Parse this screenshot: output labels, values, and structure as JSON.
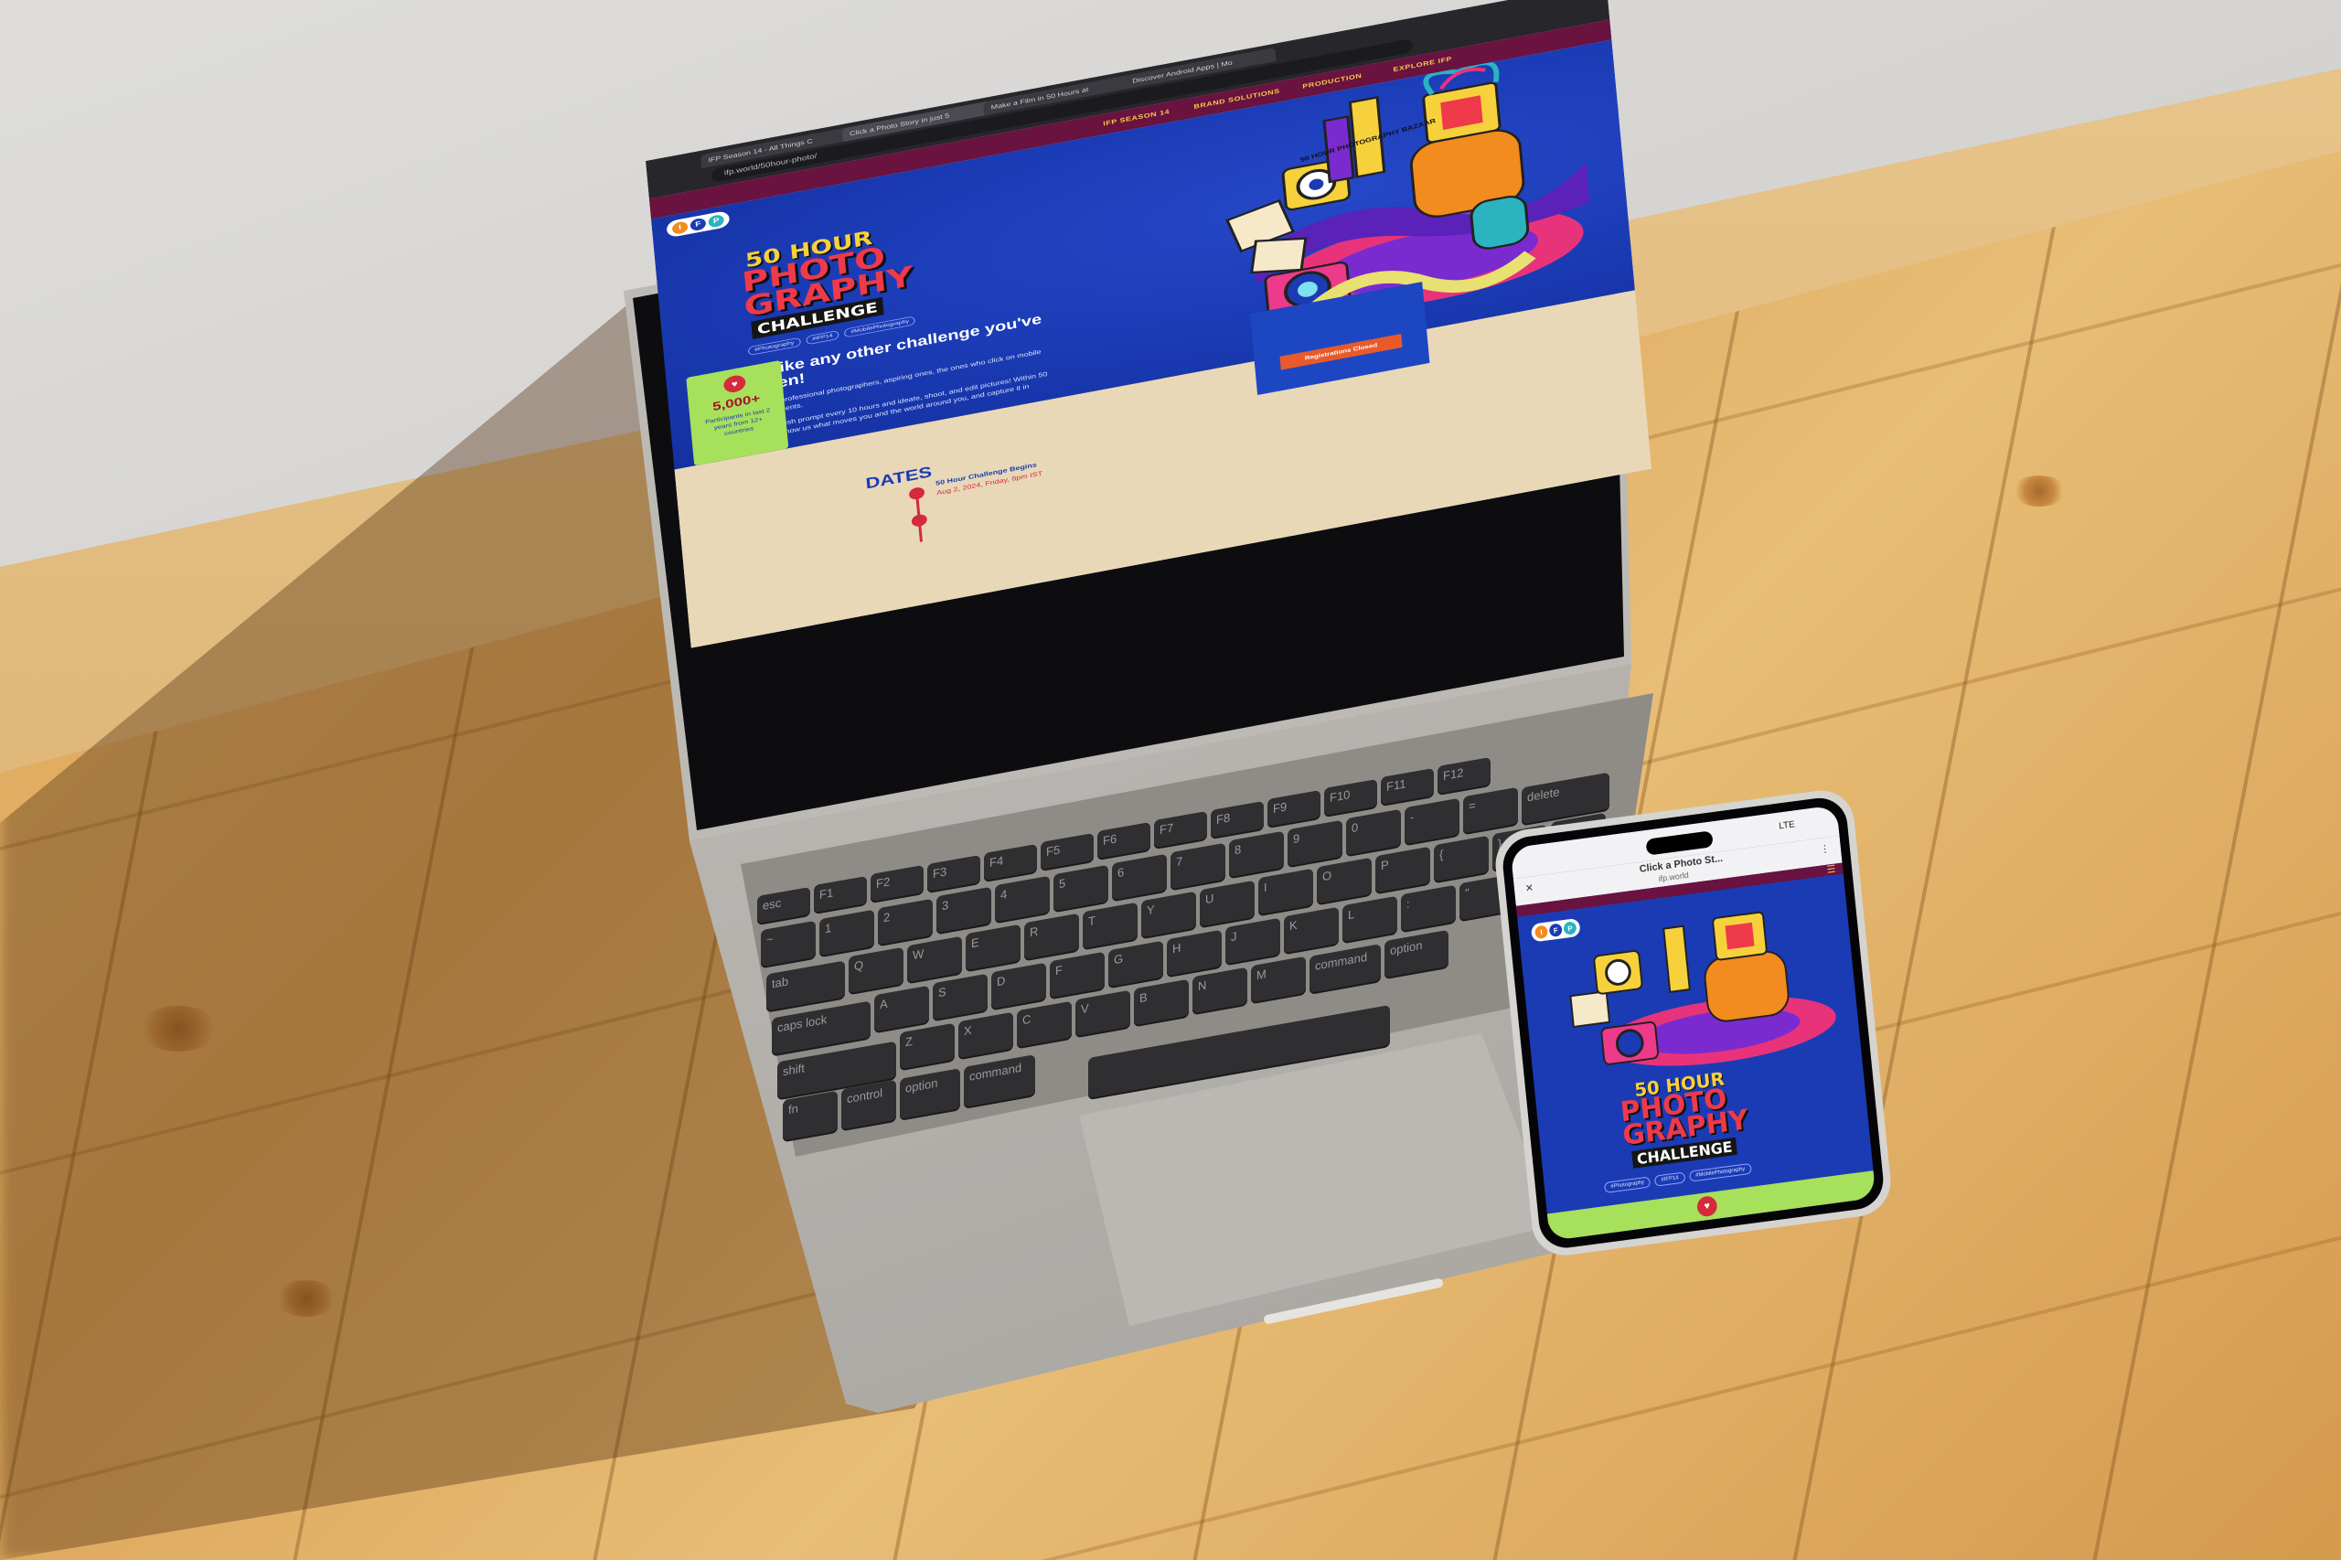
{
  "browser": {
    "tabs": [
      "IFP Season 14 - All Things C",
      "Click a Photo Story in just 5",
      "Make a Film in 50 Hours at",
      "Discover Android Apps | Mo"
    ],
    "address": "ifp.world/50hour-photo/"
  },
  "site": {
    "logo": [
      "I",
      "F",
      "P"
    ],
    "nav": [
      "IFP SEASON 14",
      "BRAND SOLUTIONS",
      "PRODUCTION",
      "EXPLORE IFP"
    ],
    "title_top": "50 HOUR",
    "title_photo": "PHOTO",
    "title_graphy": "GRAPHY",
    "title_bottom": "CHALLENGE",
    "hashtags": [
      "#Photography",
      "#IFP14",
      "#MobilePhotography"
    ],
    "headline": "Unlike any other challenge you've taken!",
    "body_1": "Calling professional photographers, aspiring ones, the ones who click on mobile and students.",
    "body_2": "Get a fresh prompt every 10 hours and ideate, shoot, and edit pictures! Within 50 hours, show us what moves you and the world around you, and capture it in frames.",
    "illustration_label": "50 HOUR PHOTOGRAPHY BAZAAR",
    "stat_number": "5,000+",
    "stat_caption": "Participants in last 2 years from 12+ countries",
    "registration_button": "Registrations Closed",
    "dates_title": "DATES",
    "date_label": "50 Hour Challenge Begins",
    "date_value": "Aug 2, 2024, Friday, 8pm IST"
  },
  "phone": {
    "tab_title": "Click a Photo St...",
    "url": "ifp.world",
    "status_right": "LTE",
    "title_top": "50 HOUR",
    "title_photo": "PHOTO",
    "title_graphy": "GRAPHY",
    "title_bottom": "CHALLENGE",
    "hashtags": [
      "#Photography",
      "#IFP14",
      "#MobilePhotography"
    ]
  },
  "keyboard": {
    "row_fn": [
      "esc",
      "F1",
      "F2",
      "F3",
      "F4",
      "F5",
      "F6",
      "F7",
      "F8",
      "F9",
      "F10",
      "F11",
      "F12"
    ],
    "row_num": [
      "~",
      "1",
      "2",
      "3",
      "4",
      "5",
      "6",
      "7",
      "8",
      "9",
      "0",
      "-",
      "=",
      "delete"
    ],
    "row_q": [
      "tab",
      "Q",
      "W",
      "E",
      "R",
      "T",
      "Y",
      "U",
      "I",
      "O",
      "P",
      "{",
      "}",
      "|"
    ],
    "row_a": [
      "caps lock",
      "A",
      "S",
      "D",
      "F",
      "G",
      "H",
      "J",
      "K",
      "L",
      ":",
      "\""
    ],
    "row_z": [
      "shift",
      "Z",
      "X",
      "C",
      "V",
      "B",
      "N",
      "M",
      "command",
      "option"
    ],
    "row_bottom": [
      "fn",
      "control",
      "option",
      "command"
    ]
  },
  "colors": {
    "brand_blue": "#1b3bb5",
    "brand_maroon": "#6a1240",
    "brand_yellow": "#f7d13c",
    "brand_red": "#ee3a4a",
    "brand_green": "#a7e05a",
    "button_orange": "#e85a2a"
  }
}
